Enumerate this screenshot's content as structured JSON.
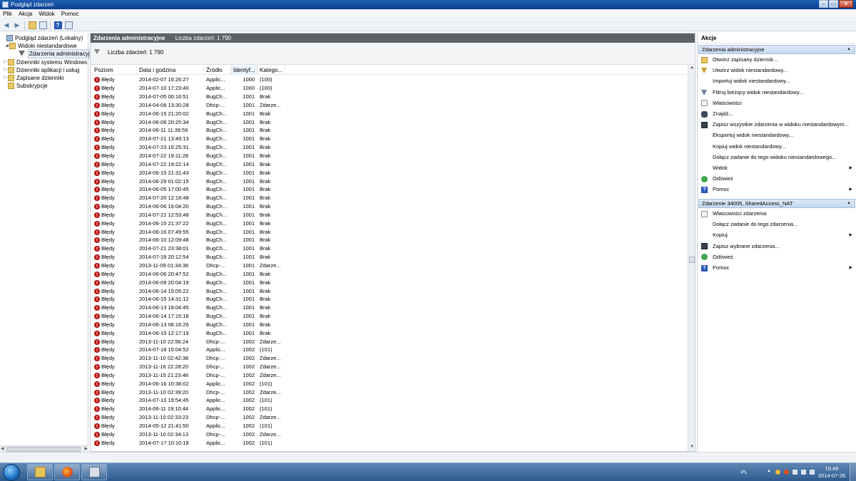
{
  "window": {
    "title": "Podgląd zdarzeń"
  },
  "menu": [
    "Plik",
    "Akcja",
    "Widok",
    "Pomoc"
  ],
  "tree": [
    {
      "label": "Podgląd zdarzeń (Lokalny)",
      "icon": "computer-icon",
      "level": 0,
      "expander": ""
    },
    {
      "label": "Widoki niestandardowe",
      "icon": "folder-icon",
      "level": 1,
      "expander": "◢"
    },
    {
      "label": "Zdarzenia administracyjne",
      "icon": "filter-icon",
      "level": 2,
      "expander": "",
      "selected": true
    },
    {
      "label": "Dzienniki systemu Windows",
      "icon": "folder-icon",
      "level": 1,
      "expander": "▷"
    },
    {
      "label": "Dzienniki aplikacji i usług",
      "icon": "folder-icon",
      "level": 1,
      "expander": "▷"
    },
    {
      "label": "Zapisane dzienniki",
      "icon": "folder-icon",
      "level": 1,
      "expander": "▷"
    },
    {
      "label": "Subskrypcje",
      "icon": "folder-icon",
      "level": 1,
      "expander": ""
    }
  ],
  "center": {
    "title": "Zdarzenia administracyjne",
    "count": "Liczba zdarzeń: 1 790",
    "filter_text": "Liczba zdarzeń: 1 790",
    "columns": [
      "Poziom",
      "Data i godzina",
      "Źródło",
      "Identyf...",
      "Katego..."
    ],
    "rows": [
      [
        "Błędy",
        "2014-02-07 16:26:27",
        "Applic...",
        "1000",
        "(100)"
      ],
      [
        "Błędy",
        "2014-07-10 17:23:40",
        "Applic...",
        "1000",
        "(100)"
      ],
      [
        "Błędy",
        "2014-07-05 00:16:51",
        "BugCh...",
        "1001",
        "Brak"
      ],
      [
        "Błędy",
        "2014-04-08 13:30:28",
        "Dhcp-...",
        "1001",
        "Zdarze..."
      ],
      [
        "Błędy",
        "2014-06-15 21:20:02",
        "BugCh...",
        "1001",
        "Brak"
      ],
      [
        "Błędy",
        "2014-06-06 20:25:34",
        "BugCh...",
        "1001",
        "Brak"
      ],
      [
        "Błędy",
        "2014-06-11 11:39:56",
        "BugCh...",
        "1001",
        "Brak"
      ],
      [
        "Błędy",
        "2014-07-21 13:49:13",
        "BugCh...",
        "1001",
        "Brak"
      ],
      [
        "Błędy",
        "2014-07-23 16:25:31",
        "BugCh...",
        "1001",
        "Brak"
      ],
      [
        "Błędy",
        "2014-07-22 19:11:28",
        "BugCh...",
        "1001",
        "Brak"
      ],
      [
        "Błędy",
        "2014-07-22 19:22:14",
        "BugCh...",
        "1001",
        "Brak"
      ],
      [
        "Błędy",
        "2014-06-15 21:31:43",
        "BugCh...",
        "1001",
        "Brak"
      ],
      [
        "Błędy",
        "2014-06-29 01:02:15",
        "BugCh...",
        "1001",
        "Brak"
      ],
      [
        "Błędy",
        "2014-06-05 17:00:45",
        "BugCh...",
        "1001",
        "Brak"
      ],
      [
        "Błędy",
        "2014-07-20 12:18:48",
        "BugCh...",
        "1001",
        "Brak"
      ],
      [
        "Błędy",
        "2014-06-06 16:04:20",
        "BugCh...",
        "1001",
        "Brak"
      ],
      [
        "Błędy",
        "2014-07-21 12:53:48",
        "BugCh...",
        "1001",
        "Brak"
      ],
      [
        "Błędy",
        "2014-06-15 21:37:22",
        "BugCh...",
        "1001",
        "Brak"
      ],
      [
        "Błędy",
        "2014-06-16 07:49:55",
        "BugCh...",
        "1001",
        "Brak"
      ],
      [
        "Błędy",
        "2014-06-10 12:09:48",
        "BugCh...",
        "1001",
        "Brak"
      ],
      [
        "Błędy",
        "2014-07-21 23:38:01",
        "BugCh...",
        "1001",
        "Brak"
      ],
      [
        "Błędy",
        "2014-07-18 20:12:54",
        "BugCh...",
        "1001",
        "Brak"
      ],
      [
        "Błędy",
        "2013-11-09 01:34:38",
        "Dhcp-...",
        "1001",
        "Zdarze..."
      ],
      [
        "Błędy",
        "2014-06-06 20:47:52",
        "BugCh...",
        "1001",
        "Brak"
      ],
      [
        "Błędy",
        "2014-06-09 20:04:19",
        "BugCh...",
        "1001",
        "Brak"
      ],
      [
        "Błędy",
        "2014-06-14 15:05:22",
        "BugCh...",
        "1001",
        "Brak"
      ],
      [
        "Błędy",
        "2014-06-15 14:31:12",
        "BugCh...",
        "1001",
        "Brak"
      ],
      [
        "Błędy",
        "2014-06-13 18:04:45",
        "BugCh...",
        "1001",
        "Brak"
      ],
      [
        "Błędy",
        "2014-06-14 17:15:18",
        "BugCh...",
        "1001",
        "Brak"
      ],
      [
        "Błędy",
        "2014-06-13 06:16:26",
        "BugCh...",
        "1001",
        "Brak"
      ],
      [
        "Błędy",
        "2014-06-15 12:17:19",
        "BugCh...",
        "1001",
        "Brak"
      ],
      [
        "Błędy",
        "2013-11-10 22:56:24",
        "Dhcp-...",
        "1002",
        "Zdarze..."
      ],
      [
        "Błędy",
        "2014-07-18 15:04:52",
        "Applic...",
        "1002",
        "(101)"
      ],
      [
        "Błędy",
        "2013-11-10 02:42:38",
        "Dhcp-...",
        "1002",
        "Zdarze..."
      ],
      [
        "Błędy",
        "2013-11-16 22:28:20",
        "Dhcp-...",
        "1002",
        "Zdarze..."
      ],
      [
        "Błędy",
        "2013-11-15 21:23:48",
        "Dhcp-...",
        "1002",
        "Zdarze..."
      ],
      [
        "Błędy",
        "2014-06-16 10:38:02",
        "Applic...",
        "1002",
        "(101)"
      ],
      [
        "Błędy",
        "2013-11-10 02:39:20",
        "Dhcp-...",
        "1002",
        "Zdarze..."
      ],
      [
        "Błędy",
        "2014-07-10 19:54:45",
        "Applic...",
        "1002",
        "(101)"
      ],
      [
        "Błędy",
        "2014-06-11 19:10:44",
        "Applic...",
        "1002",
        "(101)"
      ],
      [
        "Błędy",
        "2013-11-10 02:33:23",
        "Dhcp-...",
        "1002",
        "Zdarze..."
      ],
      [
        "Błędy",
        "2014-05-12 21:41:50",
        "Applic...",
        "1002",
        "(101)"
      ],
      [
        "Błędy",
        "2013-11-10 02:34:13",
        "Dhcp-...",
        "1002",
        "Zdarze..."
      ],
      [
        "Błędy",
        "2014-07-17 10:10:18",
        "Applic...",
        "1002",
        "(101)"
      ]
    ]
  },
  "actions": {
    "title": "Akcje",
    "section1": {
      "title": "Zdarzenia administracyjne",
      "items": [
        {
          "label": "Otwórz zapisany dziennik...",
          "icon": "open-log-icon",
          "submenu": false
        },
        {
          "label": "Utwórz widok niestandardowy...",
          "icon": "create-view-icon",
          "submenu": false
        },
        {
          "label": "Importuj widok niestandardowy...",
          "icon": "import-icon",
          "submenu": false
        },
        {
          "label": "Filtruj bieżący widok niestandardowy...",
          "icon": "filter-icon",
          "submenu": false
        },
        {
          "label": "Właściwości",
          "icon": "properties-icon",
          "submenu": false
        },
        {
          "label": "Znajdź...",
          "icon": "find-icon",
          "submenu": false
        },
        {
          "label": "Zapisz wszystkie zdarzenia w widoku niestandardowym...",
          "icon": "save-icon",
          "submenu": false
        },
        {
          "label": "Eksportuj widok niestandardowy...",
          "icon": "export-icon",
          "submenu": false
        },
        {
          "label": "Kopiuj widok niestandardowy...",
          "icon": "copy-icon",
          "submenu": false
        },
        {
          "label": "Dołącz zadanie do tego widoku niestandardowego...",
          "icon": "attach-task-icon",
          "submenu": false
        },
        {
          "label": "Widok",
          "icon": "view-icon",
          "submenu": true
        },
        {
          "label": "Odśwież",
          "icon": "refresh-icon",
          "submenu": false
        },
        {
          "label": "Pomoc",
          "icon": "help-icon",
          "submenu": true
        }
      ]
    },
    "section2": {
      "title": "Zdarzenie 34005, SharedAccess_NAT",
      "items": [
        {
          "label": "Właściwości zdarzenia",
          "icon": "event-properties-icon",
          "submenu": false
        },
        {
          "label": "Dołącz zadanie do tego zdarzenia...",
          "icon": "attach-task-icon",
          "submenu": false
        },
        {
          "label": "Kopiuj",
          "icon": "copy-icon",
          "submenu": true
        },
        {
          "label": "Zapisz wybrane zdarzenia...",
          "icon": "save-icon",
          "submenu": false
        },
        {
          "label": "Odśwież",
          "icon": "refresh-icon",
          "submenu": false
        },
        {
          "label": "Pomoc",
          "icon": "help-icon",
          "submenu": true
        }
      ]
    }
  },
  "taskbar": {
    "apps": [
      "windows-explorer-icon",
      "firefox-icon",
      "event-viewer-icon"
    ],
    "language": "PL",
    "time": "15:46",
    "date": "2014-07-26"
  }
}
